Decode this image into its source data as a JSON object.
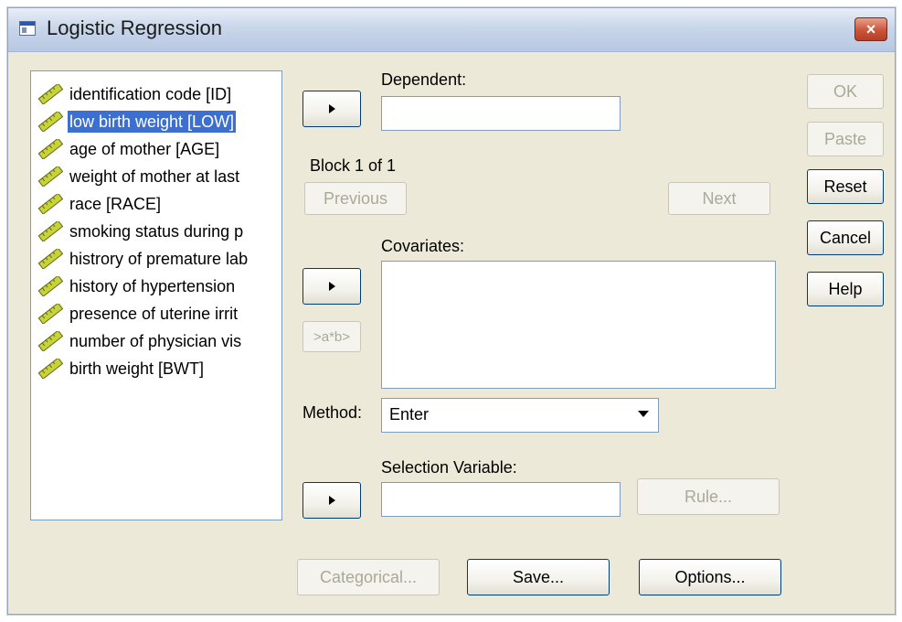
{
  "window": {
    "title": "Logistic Regression",
    "close_glyph": "×"
  },
  "variables": [
    {
      "label": "identification code [ID]",
      "selected": false
    },
    {
      "label": "low birth weight [LOW]",
      "selected": true
    },
    {
      "label": "age of mother [AGE]",
      "selected": false
    },
    {
      "label": "weight of mother at last",
      "selected": false
    },
    {
      "label": "race [RACE]",
      "selected": false
    },
    {
      "label": "smoking status during p",
      "selected": false
    },
    {
      "label": "histrory of premature lab",
      "selected": false
    },
    {
      "label": "history of hypertension",
      "selected": false
    },
    {
      "label": "presence of uterine irrit",
      "selected": false
    },
    {
      "label": "number of physician vis",
      "selected": false
    },
    {
      "label": "birth weight [BWT]",
      "selected": false
    }
  ],
  "dependent": {
    "label": "Dependent:",
    "value": ""
  },
  "block": {
    "label": "Block 1 of 1",
    "previous": "Previous",
    "next": "Next"
  },
  "covariates": {
    "label": "Covariates:",
    "interaction_button": ">a*b>"
  },
  "method": {
    "label": "Method:",
    "value": "Enter"
  },
  "selection": {
    "label": "Selection Variable:",
    "value": "",
    "rule_button": "Rule..."
  },
  "side_buttons": {
    "ok": "OK",
    "paste": "Paste",
    "reset": "Reset",
    "cancel": "Cancel",
    "help": "Help"
  },
  "bottom_buttons": {
    "categorical": "Categorical...",
    "save": "Save...",
    "options": "Options..."
  },
  "icons": {
    "variable_icon": "scale-ruler-icon",
    "arrow_icon": "right-arrow-icon"
  },
  "colors": {
    "selection": "#3d6fd1",
    "dialog_bg": "#ece9d8",
    "disabled_text": "#aca899"
  }
}
